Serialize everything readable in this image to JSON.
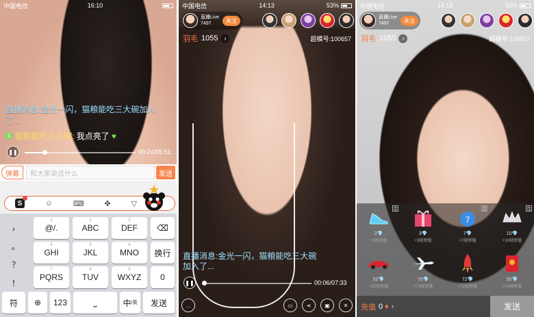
{
  "panel1": {
    "status": {
      "carrier": "中国电信",
      "time": "16:10"
    },
    "chat_notice": "直播消息:金光一闪，猫粮能吃三大碗加入了...",
    "message": {
      "level": "5",
      "name": "猫粮能吃三大碗:",
      "text": "我点亮了"
    },
    "playback": {
      "time": "00:24/05:51",
      "progress": 0.18
    },
    "input": {
      "danmu_label": "弹幕",
      "placeholder": "和大家说点什么",
      "send_label": "发送"
    },
    "keyboard": {
      "side_keys": [
        "，",
        "。",
        "？",
        "！"
      ],
      "rows": [
        [
          {
            "main": "@/.",
            "sub": "1"
          },
          {
            "main": "ABC",
            "sub": "2"
          },
          {
            "main": "DEF",
            "sub": "3"
          },
          {
            "main": "⌫",
            "sub": ""
          }
        ],
        [
          {
            "main": "GHI",
            "sub": "4"
          },
          {
            "main": "JKL",
            "sub": "5"
          },
          {
            "main": "MNO",
            "sub": "6"
          },
          {
            "main": "换行",
            "sub": ""
          }
        ],
        [
          {
            "main": "PQRS",
            "sub": "7"
          },
          {
            "main": "TUV",
            "sub": "8"
          },
          {
            "main": "WXYZ",
            "sub": "9"
          },
          {
            "main": "0",
            "sub": ""
          }
        ]
      ],
      "bottom": {
        "symbol": "符",
        "numeric": "123",
        "space": "⎵",
        "lang": "中",
        "lang_sub": "/英",
        "send": "发送"
      }
    }
  },
  "panel2": {
    "status": {
      "carrier": "中国电信",
      "time": "14:13",
      "battery": "53%"
    },
    "host": {
      "name": "直播Live",
      "id": "7497",
      "follow_label": "关注"
    },
    "sub": {
      "label": "羽毛",
      "count": "1055",
      "super_id": "超模号:100657"
    },
    "chat_notice": "直播消息:金光一闪，猫粮能吃三大碗加入了...",
    "playback": {
      "time": "00:06/07:33",
      "progress": 0.02
    }
  },
  "panel3": {
    "status": {
      "carrier": "中国电信",
      "time": "14:13",
      "battery": "52%"
    },
    "host": {
      "name": "直播Live",
      "id": "7497",
      "follow_label": "关注"
    },
    "sub": {
      "label": "羽毛",
      "count": "1055",
      "super_id": "超模号:100657"
    },
    "gifts": [
      {
        "icon": "glass-shoe-icon",
        "price": "2",
        "exp": "+2经验值"
      },
      {
        "icon": "gift-box-icon",
        "price": "3",
        "exp": "+3经验值"
      },
      {
        "icon": "apple-icon",
        "price": "7",
        "exp": "+7经验值"
      },
      {
        "icon": "crown-icon",
        "price": "10",
        "exp": "+10经验值"
      },
      {
        "icon": "sports-car-icon",
        "price": "52",
        "exp": "+52经验值"
      },
      {
        "icon": "airplane-icon",
        "price": "70",
        "exp": "+70经验值"
      },
      {
        "icon": "rocket-icon",
        "price": "72",
        "exp": "+72经验值"
      },
      {
        "icon": "red-envelope-icon",
        "price": "50",
        "exp": "+50经验值"
      }
    ],
    "gift_tag": "连",
    "recharge_label": "充值",
    "recharge_value": "0",
    "send_label": "发送"
  },
  "colors": {
    "accent": "#f7854c",
    "notice": "#9fe0ff",
    "pink_shirt": "#ef7080"
  }
}
